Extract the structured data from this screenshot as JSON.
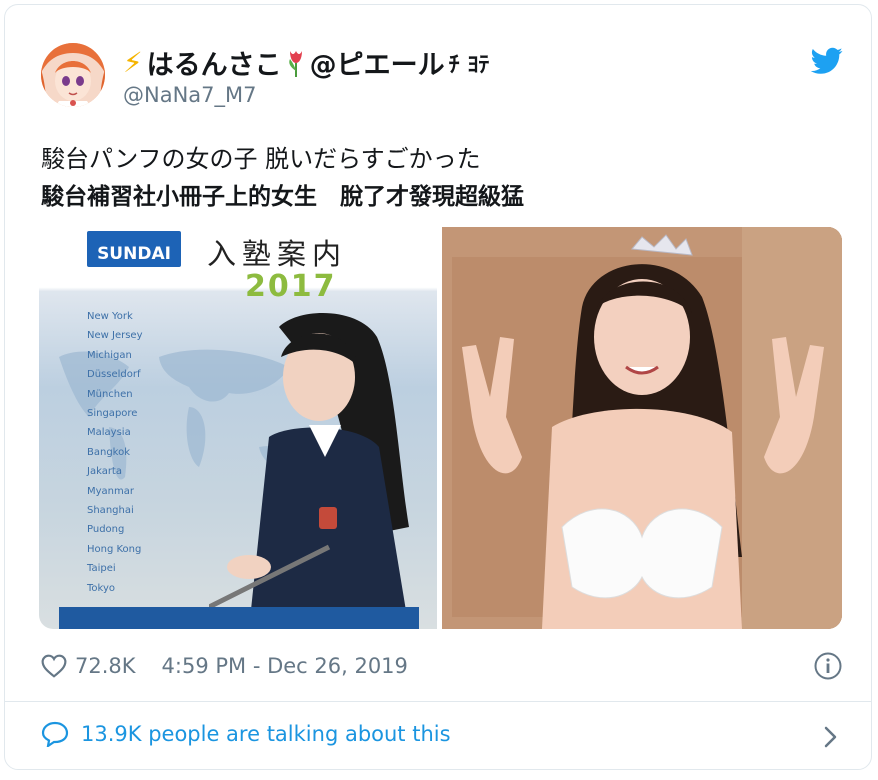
{
  "tweet": {
    "display_name": "はるんさこ",
    "display_name_suffix": "@ピエール",
    "display_name_tag": "ﾁ ﾖﾃ",
    "handle": "@NaNa7_M7",
    "text_line1": "駿台パンフの女の子 脱いだらすごかった",
    "text_line2": "駿台補習社小冊子上的女生　脫了才發現超級猛",
    "likes": "72.8K",
    "timestamp": "4:59 PM - Dec 26, 2019",
    "talking": "13.9K people are talking about this"
  },
  "media": {
    "left": {
      "logo_text": "SUNDAI",
      "title": "入塾案内",
      "year": "2017",
      "cities": [
        "New York",
        "New Jersey",
        "Michigan",
        "Düsseldorf",
        "München",
        "Singapore",
        "Malaysia",
        "Bangkok",
        "Jakarta",
        "Myanmar",
        "Shanghai",
        "Pudong",
        "Hong Kong",
        "Taipei",
        "Tokyo"
      ]
    }
  },
  "icons": {
    "brand": "twitter-bird-icon",
    "like": "heart-icon",
    "info": "info-icon",
    "reply": "speech-bubble-icon",
    "more": "chevron-right-icon"
  },
  "colors": {
    "twitter_blue": "#1da1f2",
    "link_blue": "#1b95e0",
    "muted": "#657786",
    "border": "#e1e8ed"
  }
}
